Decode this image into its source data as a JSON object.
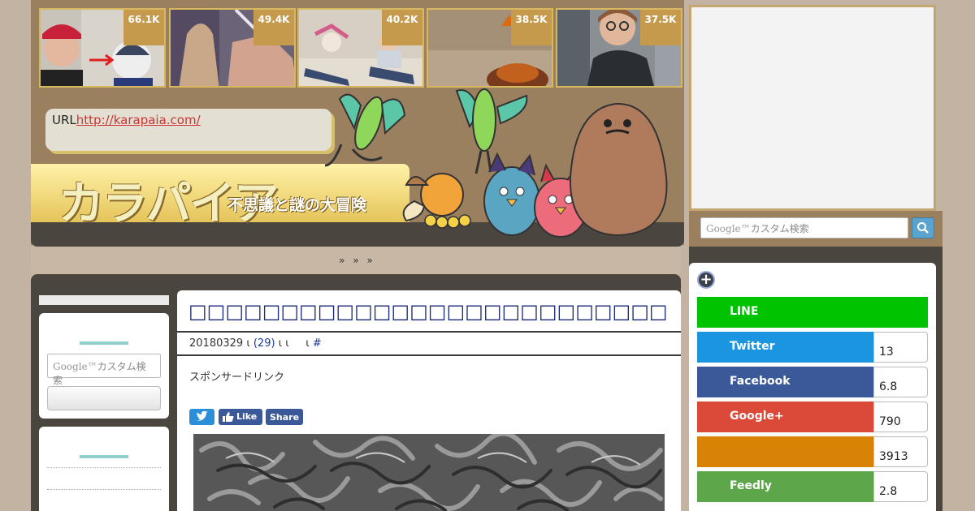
{
  "thumbs": [
    {
      "count": "66.1K"
    },
    {
      "count": "49.4K"
    },
    {
      "count": "40.2K"
    },
    {
      "count": "38.5K"
    },
    {
      "count": "37.5K"
    }
  ],
  "site": {
    "url_label": "URL",
    "url": "http://karapaia.com/",
    "logo": "カラパイア",
    "tagline": "不思議と謎の大冒険"
  },
  "nav": {
    "text": "»  »    »"
  },
  "search": {
    "google": "Google™",
    "placeholder": "カスタム検索"
  },
  "article": {
    "title": "□□□□□□□□□□□□□□□□□□□□□□□□□□□□□□□□□□□□□□□□□",
    "date": "20180329",
    "sep1": "ι",
    "comments": "(29)",
    "sep2": "ι  ι",
    "sep3": "ι",
    "hash": "#",
    "sponsor": "スポンサードリンク",
    "fb_like": "Like",
    "fb_share": "Share"
  },
  "share_buttons": [
    {
      "label": "LINE",
      "count": "",
      "color": "#00c300"
    },
    {
      "label": "Twitter",
      "count": "13",
      "color": "#1b95e0"
    },
    {
      "label": "Facebook",
      "count": "6.8",
      "color": "#3b5998"
    },
    {
      "label": "Google+",
      "count": "790",
      "color": "#db4a39"
    },
    {
      "label": "",
      "count": "3913",
      "color": "#d98306"
    },
    {
      "label": "Feedly",
      "count": "2.8",
      "color": "#5ea64a"
    }
  ]
}
